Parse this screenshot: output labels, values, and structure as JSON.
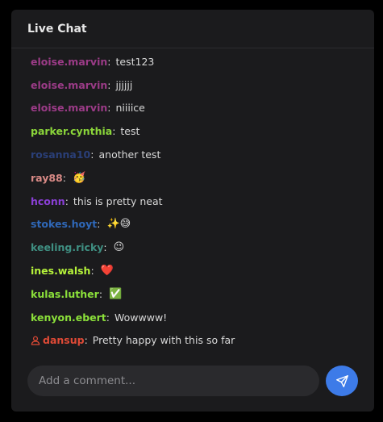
{
  "header": {
    "title": "Live Chat"
  },
  "messages": [
    {
      "author": "eloise.marvin",
      "text": "test123",
      "color": "#9b3b87"
    },
    {
      "author": "eloise.marvin",
      "text": "jjjjjj",
      "color": "#9b3b87"
    },
    {
      "author": "eloise.marvin",
      "text": "niiiice",
      "color": "#9b3b87"
    },
    {
      "author": "parker.cynthia",
      "text": "test",
      "color": "#8bd63a"
    },
    {
      "author": "rosanna10",
      "text": "another test",
      "color": "#2a3f78"
    },
    {
      "author": "ray88",
      "text": "🥳",
      "color": "#d98a86"
    },
    {
      "author": "hconn",
      "text": "this is pretty neat",
      "color": "#8a3fd6"
    },
    {
      "author": "stokes.hoyt",
      "text": "✨😅",
      "color": "#2f68b8"
    },
    {
      "author": "keeling.ricky",
      "text": "😉",
      "color": "#3f8f82"
    },
    {
      "author": "ines.walsh",
      "text": "❤️",
      "color": "#b5f23a"
    },
    {
      "author": "kulas.luther",
      "text": "✅",
      "color": "#8be03a"
    },
    {
      "author": "kenyon.ebert",
      "text": "Wowwww!",
      "color": "#8be03a"
    },
    {
      "author": "dansup",
      "text": "Pretty happy with this so far",
      "color": "#e04a36",
      "host_icon": "user-icon"
    }
  ],
  "composer": {
    "placeholder": "Add a comment...",
    "send_icon": "send-icon",
    "send_color": "#3d7be8"
  }
}
